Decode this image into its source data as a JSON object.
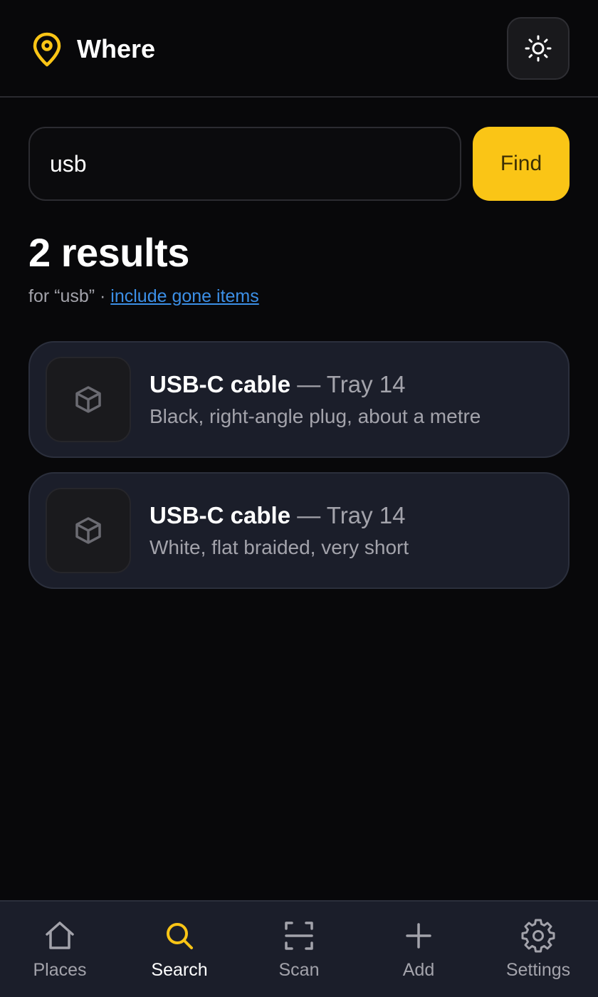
{
  "app": {
    "title": "Where"
  },
  "search": {
    "value": "usb",
    "button_label": "Find"
  },
  "results": {
    "count_label": "2 results",
    "query_label": "for “usb” · ",
    "include_gone_label": "include gone items"
  },
  "items": [
    {
      "name": "USB-C cable",
      "location": " — Tray 14",
      "description": "Black, right-angle plug, about a metre",
      "icon": "box-icon"
    },
    {
      "name": "USB-C cable",
      "location": " — Tray 14",
      "description": "White, flat braided, very short",
      "icon": "box-icon"
    }
  ],
  "nav": [
    {
      "label": "Places",
      "icon": "home-icon",
      "active": false
    },
    {
      "label": "Search",
      "icon": "search-icon",
      "active": true
    },
    {
      "label": "Scan",
      "icon": "scan-icon",
      "active": false
    },
    {
      "label": "Add",
      "icon": "plus-icon",
      "active": false
    },
    {
      "label": "Settings",
      "icon": "gear-icon",
      "active": false
    }
  ],
  "colors": {
    "accent": "#fac516",
    "background": "#08080a",
    "card": "#1b1e2a",
    "link": "#3c8fe6",
    "muted_text": "#a3a3ab"
  }
}
